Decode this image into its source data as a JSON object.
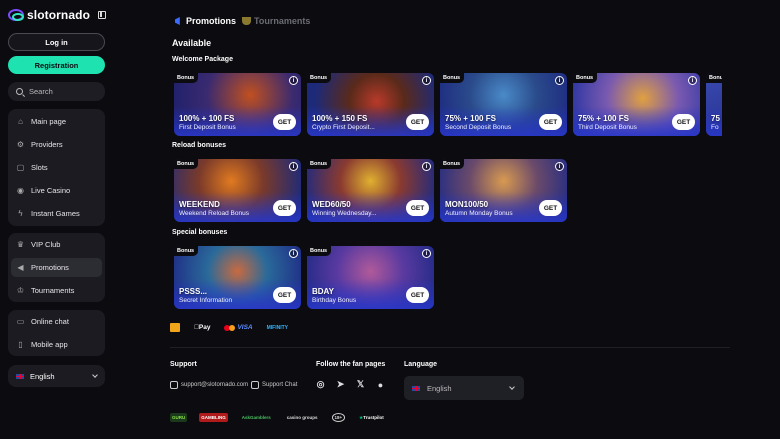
{
  "brand": {
    "logo_text": "slotornado"
  },
  "sidebar": {
    "login": "Log in",
    "registration": "Registration",
    "search": "Search",
    "group1": [
      {
        "label": "Main page",
        "icon": "home-icon"
      },
      {
        "label": "Providers",
        "icon": "providers-icon"
      },
      {
        "label": "Slots",
        "icon": "slots-icon"
      },
      {
        "label": "Live Casino",
        "icon": "live-casino-icon"
      },
      {
        "label": "Instant Games",
        "icon": "lightning-icon"
      }
    ],
    "group2": [
      {
        "label": "VIP Club",
        "icon": "crown-icon"
      },
      {
        "label": "Promotions",
        "icon": "megaphone-icon",
        "active": true
      },
      {
        "label": "Tournaments",
        "icon": "trophy-icon"
      }
    ],
    "group3": [
      {
        "label": "Online chat",
        "icon": "chat-icon"
      },
      {
        "label": "Mobile app",
        "icon": "phone-icon"
      }
    ],
    "language": "English"
  },
  "tabs": {
    "promotions": "Promotions",
    "tournaments": "Tournaments"
  },
  "main": {
    "available": "Available",
    "welcome_title": "Welcome Package",
    "reload_title": "Reload bonuses",
    "special_title": "Special bonuses",
    "badge": "Bonus",
    "get": "GET",
    "welcome": [
      {
        "title": "100% + 100 FS",
        "sub": "First Deposit Bonus"
      },
      {
        "title": "100% + 150 FS",
        "sub": "Crypto First Deposit..."
      },
      {
        "title": "75% + 100 FS",
        "sub": "Second Deposit Bonus"
      },
      {
        "title": "75% + 100 FS",
        "sub": "Third Deposit Bonus"
      },
      {
        "title": "75",
        "sub": "Fo"
      }
    ],
    "reload": [
      {
        "title": "WEEKEND",
        "sub": "Weekend Reload Bonus"
      },
      {
        "title": "WED60/50",
        "sub": "Winning Wednesday..."
      },
      {
        "title": "MON100/50",
        "sub": "Autumn Monday Bonus"
      }
    ],
    "special": [
      {
        "title": "PSSS...",
        "sub": "Secret Information"
      },
      {
        "title": "BDAY",
        "sub": "Birthday Bonus"
      }
    ]
  },
  "payments": {
    "apple_pay": "Pay",
    "visa": "VISA",
    "mifinity": "MIFINITY"
  },
  "footer": {
    "support": "Support",
    "email": "support@slotornado.com",
    "support_chat": "Support Chat",
    "fan_pages": "Follow the fan pages",
    "language_label": "Language",
    "language_value": "English",
    "partners": [
      "GURU",
      "GAMBLING",
      "AskGamblers",
      "casino groups",
      "18+",
      "Trustpilot"
    ]
  },
  "colors": {
    "accent": "#1ee3b0",
    "brand_purple": "#7c4dff",
    "card_blue": "#2837c8"
  }
}
